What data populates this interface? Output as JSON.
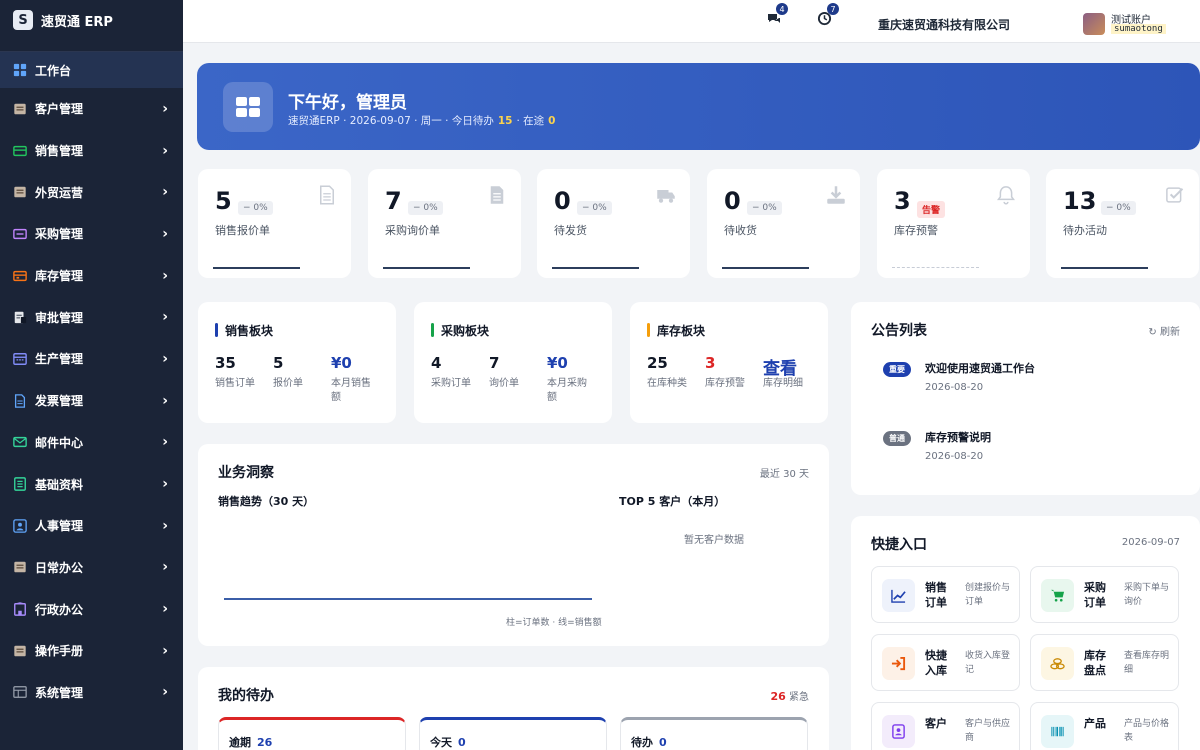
{
  "app": {
    "logo_glyph": "S",
    "title": "速贸通 ERP"
  },
  "sidebar": {
    "items": [
      {
        "label": "工作台",
        "icon": "dashboard-icon",
        "color": "#60a5fa"
      },
      {
        "label": "客户管理",
        "icon": "box-icon",
        "color": "#c4b5a5"
      },
      {
        "label": "销售管理",
        "icon": "cash-icon",
        "color": "#22c55e"
      },
      {
        "label": "外贸运营",
        "icon": "box-icon",
        "color": "#c4b5a5"
      },
      {
        "label": "采购管理",
        "icon": "card-icon",
        "color": "#c084fc"
      },
      {
        "label": "库存管理",
        "icon": "warehouse-icon",
        "color": "#f97316"
      },
      {
        "label": "审批管理",
        "icon": "clipboard-icon",
        "color": "#e5e7eb"
      },
      {
        "label": "生产管理",
        "icon": "calendar-icon",
        "color": "#818cf8"
      },
      {
        "label": "发票管理",
        "icon": "invoice-icon",
        "color": "#60a5fa"
      },
      {
        "label": "邮件中心",
        "icon": "mail-icon",
        "color": "#34d399"
      },
      {
        "label": "基础资料",
        "icon": "list-icon",
        "color": "#34d399"
      },
      {
        "label": "人事管理",
        "icon": "person-icon",
        "color": "#60a5fa"
      },
      {
        "label": "日常办公",
        "icon": "box-icon",
        "color": "#c4b5a5"
      },
      {
        "label": "行政办公",
        "icon": "building-icon",
        "color": "#a78bfa"
      },
      {
        "label": "操作手册",
        "icon": "box-icon",
        "color": "#c4b5a5"
      },
      {
        "label": "系统管理",
        "icon": "settings-panel-icon",
        "color": "#9ca3af"
      }
    ]
  },
  "header": {
    "chat_badge": "4",
    "clock_badge": "7",
    "company": "重庆速贸通科技有限公司",
    "user_name": "测试账户",
    "user_account": "sumaotong"
  },
  "banner": {
    "greeting": "下午好，管理员",
    "sub_prefix": "速贸通ERP · 2026-09-07 · 周一 · 今日待办",
    "todo_count": "15",
    "sub_mid": "· 在途",
    "transit_count": "0"
  },
  "kpis": [
    {
      "value": "5",
      "pct": "− 0%",
      "label": "销售报价单",
      "icon": "document-icon"
    },
    {
      "value": "7",
      "pct": "− 0%",
      "label": "采购询价单",
      "icon": "file-icon"
    },
    {
      "value": "0",
      "pct": "− 0%",
      "label": "待发货",
      "icon": "truck-icon"
    },
    {
      "value": "0",
      "pct": "− 0%",
      "label": "待收货",
      "icon": "download-icon"
    },
    {
      "value": "3",
      "pct": "告警",
      "label": "库存预警",
      "icon": "bell-icon"
    },
    {
      "value": "13",
      "pct": "− 0%",
      "label": "待办活动",
      "icon": "check-square-icon"
    }
  ],
  "blocks": [
    {
      "title": "销售板块",
      "color": "#1e40af",
      "items": [
        {
          "num": "35",
          "label": "销售订单"
        },
        {
          "num": "5",
          "label": "报价单"
        },
        {
          "num": "¥0",
          "label": "本月销售额"
        }
      ]
    },
    {
      "title": "采购板块",
      "color": "#16a34a",
      "items": [
        {
          "num": "4",
          "label": "采购订单"
        },
        {
          "num": "7",
          "label": "询价单"
        },
        {
          "num": "¥0",
          "label": "本月采购额"
        }
      ]
    },
    {
      "title": "库存板块",
      "color": "#f59e0b",
      "items": [
        {
          "num": "25",
          "label": "在库种类"
        },
        {
          "num": "3",
          "label": "库存预警"
        },
        {
          "num": "查看",
          "label": "库存明细"
        }
      ]
    }
  ],
  "insight": {
    "title": "业务洞察",
    "range": "最近 30 天",
    "trend_title": "销售趋势（30 天）",
    "top_title": "TOP 5 客户（本月）",
    "top_empty": "暂无客户数据",
    "legend": "柱=订单数 · 线=销售额"
  },
  "chart_data": {
    "type": "bar",
    "title": "销售趋势（30 天）",
    "series": [
      {
        "name": "订单数",
        "values": []
      },
      {
        "name": "销售额",
        "values": []
      }
    ]
  },
  "notices": {
    "title": "公告列表",
    "refresh": "刷新",
    "items": [
      {
        "tag": "重要",
        "tag_color": "#1e40af",
        "title": "欢迎使用速贸通工作台",
        "date": "2026-08-20"
      },
      {
        "tag": "普通",
        "tag_color": "#6b7280",
        "title": "库存预警说明",
        "date": "2026-08-20"
      }
    ]
  },
  "quick": {
    "title": "快捷入口",
    "date": "2026-09-07",
    "items": [
      {
        "title": "销售订单",
        "desc": "创建报价与订单",
        "icon": "chart-line-icon",
        "bg": "#eef2fb",
        "fg": "#1e40af"
      },
      {
        "title": "采购订单",
        "desc": "采购下单与询价",
        "icon": "cart-icon",
        "bg": "#e8f7ee",
        "fg": "#16a34a"
      },
      {
        "title": "快捷入库",
        "desc": "收货入库登记",
        "icon": "sign-in-icon",
        "bg": "#fdf1e7",
        "fg": "#ea580c"
      },
      {
        "title": "库存盘点",
        "desc": "查看库存明细",
        "icon": "coins-icon",
        "bg": "#fdf6e3",
        "fg": "#ca8a04"
      },
      {
        "title": "客户",
        "desc": "客户与供应商",
        "icon": "contact-icon",
        "bg": "#f3ecfb",
        "fg": "#7c3aed"
      },
      {
        "title": "产品",
        "desc": "产品与价格表",
        "icon": "barcode-icon",
        "bg": "#e6f6f8",
        "fg": "#0891b2"
      }
    ]
  },
  "todos": {
    "title": "我的待办",
    "urgent_count": "26",
    "urgent_label": "紧急",
    "cards": [
      {
        "label": "逾期",
        "count": "26",
        "color": "#dc2626"
      },
      {
        "label": "今天",
        "count": "0",
        "color": "#1e40af"
      },
      {
        "label": "待办",
        "count": "0",
        "color": "#9ca3af"
      }
    ]
  }
}
